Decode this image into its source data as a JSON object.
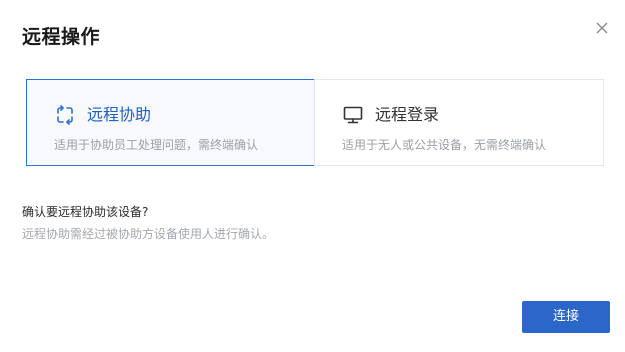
{
  "dialog": {
    "title": "远程操作"
  },
  "options": [
    {
      "id": "remote-assist",
      "label": "远程协助",
      "description": "适用于协助员工处理问题，需终端确认",
      "icon": "remote-assist-icon",
      "selected": true
    },
    {
      "id": "remote-login",
      "label": "远程登录",
      "description": "适用于无人或公共设备，无需终端确认",
      "icon": "monitor-icon",
      "selected": false
    }
  ],
  "prompt": {
    "question": "确认要远程协助该设备?",
    "hint": "远程协助需经过被协助方设备使用人进行确认。"
  },
  "actions": {
    "connect_label": "连接"
  },
  "colors": {
    "accent": "#2b66c9",
    "selected_border": "#2e6fd0",
    "selected_background": "#f7f9fd"
  }
}
